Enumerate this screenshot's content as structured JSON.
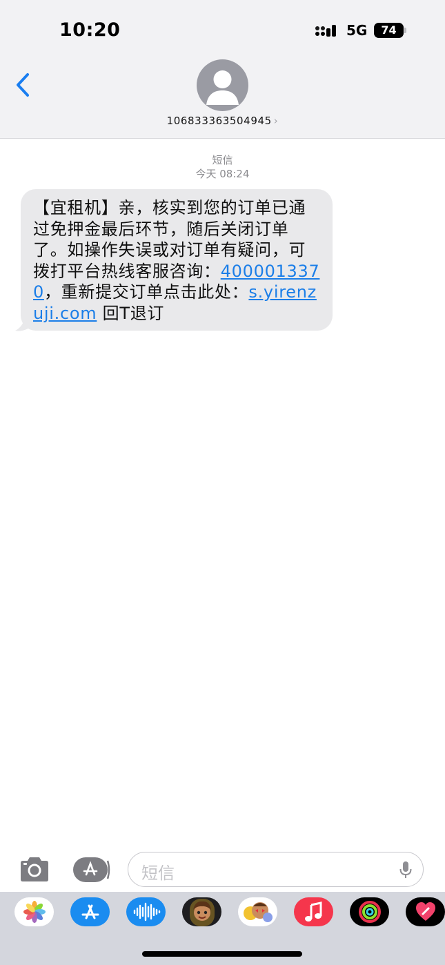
{
  "status_bar": {
    "time": "10:20",
    "network": "5G",
    "battery": "74"
  },
  "header": {
    "contact": "106833363504945"
  },
  "conversation": {
    "service": "短信",
    "timestamp": "今天 08:24"
  },
  "message": {
    "part1": "【宜租机】亲，核实到您的订单已通过免押金最后环节，随后关闭订单了。如操作失误或对订单有疑问，可拨打平台热线客服咨询：",
    "phone": "4000013370",
    "part2": "，重新提交订单点击此处：",
    "link": "s.yirenzuji.com",
    "part3": " 回T退订"
  },
  "input": {
    "placeholder": "短信"
  },
  "app_drawer": [
    "photos-icon",
    "app-store-icon",
    "audio-message-icon",
    "memoji-icon",
    "memoji-stickers-icon",
    "music-icon",
    "activity-icon",
    "digital-touch-icon"
  ],
  "colors": {
    "link": "#1b7ee8",
    "accent": "#1a7ef0",
    "bubble": "#e9e9eb"
  }
}
